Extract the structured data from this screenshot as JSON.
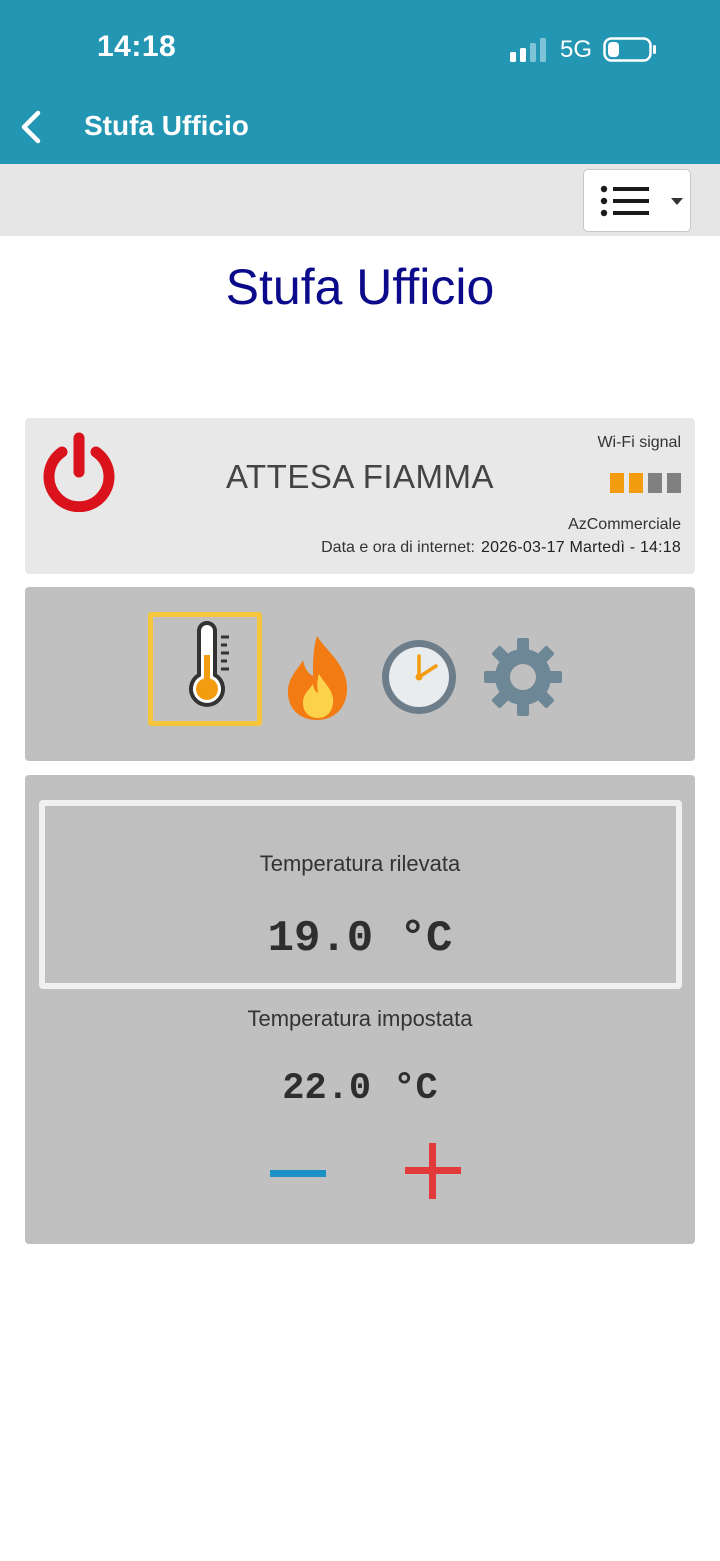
{
  "status_bar": {
    "time": "14:18",
    "network": "5G"
  },
  "header": {
    "back_icon": "chevron-left-icon",
    "title": "Stufa Ufficio"
  },
  "toolbar": {
    "menu_icon": "list-icon",
    "menu_caret_icon": "caret-down-icon"
  },
  "page": {
    "title": "Stufa Ufficio"
  },
  "status_card": {
    "power_icon": "power-icon",
    "power_color": "#d9121b",
    "state": "ATTESA FIAMMA",
    "wifi_label": "Wi-Fi signal",
    "wifi_level": 2,
    "wifi_level_max": 4,
    "wifi_active_color": "#f49c10",
    "wifi_inactive_color": "#808080",
    "owner": "AzCommerciale",
    "datetime_label": "Data e ora di internet:",
    "datetime_value": "2026-03-17 Martedì - 14:18"
  },
  "mode_tabs": [
    {
      "name": "thermometer-icon",
      "selected": true
    },
    {
      "name": "flame-icon",
      "selected": false
    },
    {
      "name": "clock-icon",
      "selected": false
    },
    {
      "name": "gear-icon",
      "selected": false
    }
  ],
  "temperature": {
    "measured_label": "Temperatura rilevata",
    "measured_value": "19.0 °C",
    "set_label": "Temperatura impostata",
    "set_value": "22.0 °C",
    "decrease_icon": "minus-icon",
    "increase_icon": "plus-icon",
    "decrease_color": "#1e90c8",
    "increase_color": "#e23a3a"
  }
}
